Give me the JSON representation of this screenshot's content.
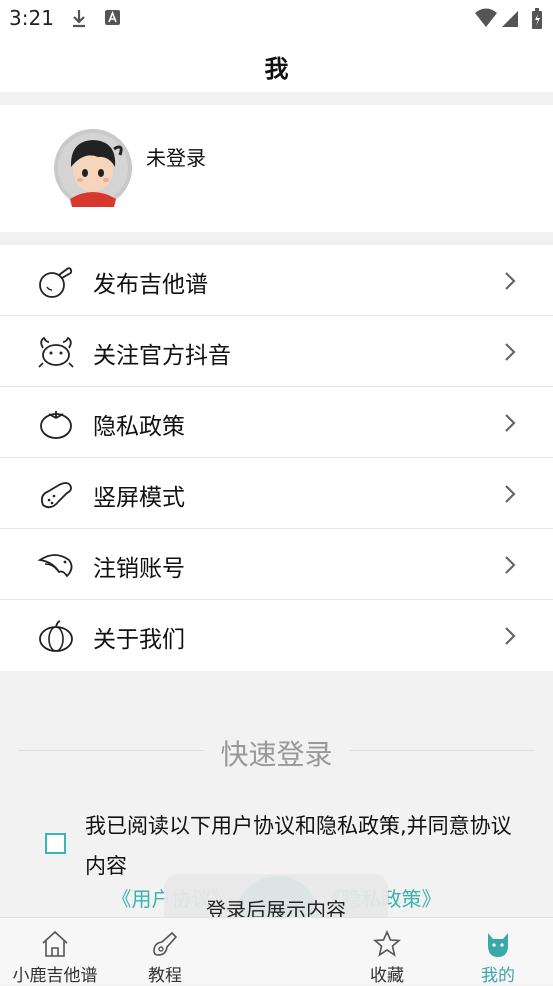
{
  "status_bar": {
    "time": "3:21"
  },
  "header": {
    "title": "我"
  },
  "profile": {
    "status": "未登录"
  },
  "menu": [
    {
      "label": "发布吉他谱",
      "icon": "peach-icon"
    },
    {
      "label": "关注官方抖音",
      "icon": "crab-icon"
    },
    {
      "label": "隐私政策",
      "icon": "tomato-icon"
    },
    {
      "label": "竖屏模式",
      "icon": "chicken-leg-icon"
    },
    {
      "label": "注销账号",
      "icon": "shrimp-icon"
    },
    {
      "label": "关于我们",
      "icon": "pumpkin-icon"
    }
  ],
  "quick_login": {
    "title": "快速登录",
    "agreement": "我已阅读以下用户协议和隐私政策,并同意协议内容",
    "user_agreement": "《用户协议》",
    "privacy_policy": "《隐私政策》",
    "checked": false
  },
  "toast": "登录后展示内容",
  "tabs": [
    {
      "label": "小鹿吉他谱",
      "icon": "home-icon",
      "active": false
    },
    {
      "label": "教程",
      "icon": "guitar-icon",
      "active": false
    },
    {
      "label": "收藏",
      "icon": "star-icon",
      "active": false
    },
    {
      "label": "我的",
      "icon": "cat-icon",
      "active": true
    }
  ],
  "colors": {
    "accent": "#3ba8a8",
    "background": "#f1f1f1"
  }
}
